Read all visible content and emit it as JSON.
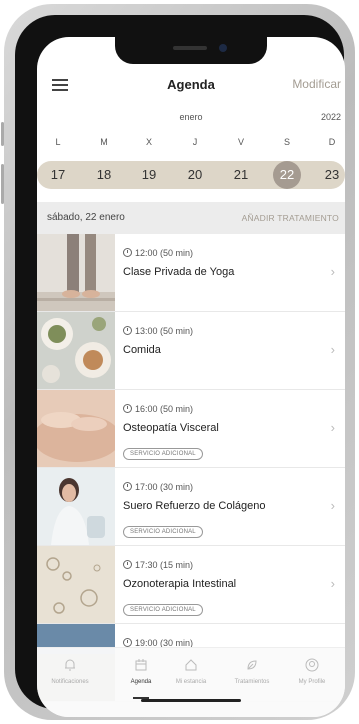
{
  "header": {
    "title": "Agenda",
    "modify_label": "Modificar"
  },
  "calendar": {
    "month": "enero",
    "year": "2022",
    "weekdays": [
      "L",
      "M",
      "X",
      "J",
      "V",
      "S",
      "D"
    ],
    "days": [
      "17",
      "18",
      "19",
      "20",
      "21",
      "22",
      "23"
    ],
    "selected_day": "22"
  },
  "section": {
    "date_label": "sábado, 22 enero",
    "add_label": "AÑADIR TRATAMIENTO"
  },
  "appointments": [
    {
      "time": "12:00 (50 min)",
      "name": "Clase Privada de Yoga",
      "badge": ""
    },
    {
      "time": "13:00 (50 min)",
      "name": "Comida",
      "badge": ""
    },
    {
      "time": "16:00 (50 min)",
      "name": "Osteopatía Visceral",
      "badge": "SERVICIO ADICIONAL"
    },
    {
      "time": "17:00 (30 min)",
      "name": "Suero Refuerzo de Colágeno",
      "badge": "SERVICIO ADICIONAL"
    },
    {
      "time": "17:30 (15 min)",
      "name": "Ozonoterapia Intestinal",
      "badge": "SERVICIO ADICIONAL"
    },
    {
      "time": "19:00 (30 min)",
      "name": "",
      "badge": ""
    }
  ],
  "bottom_nav": [
    {
      "label": "Notificaciones",
      "icon": "bell-icon"
    },
    {
      "label": "Agenda",
      "icon": "calendar-icon"
    },
    {
      "label": "Mi estancia",
      "icon": "house-icon"
    },
    {
      "label": "Tratamientos",
      "icon": "leaf-icon"
    },
    {
      "label": "My Profile",
      "icon": "profile-icon"
    }
  ],
  "colors": {
    "accent": "#a59b91",
    "strip": "#ddd6c8",
    "section_bg": "#ececec"
  }
}
